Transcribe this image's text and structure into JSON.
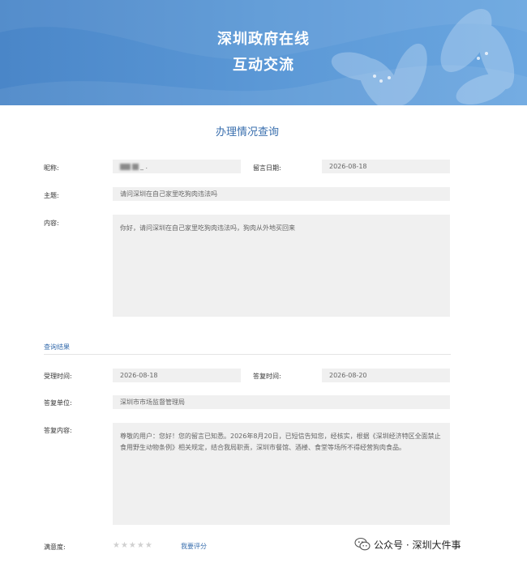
{
  "header": {
    "title_line1": "深圳政府在线",
    "title_line2": "互动交流",
    "colors": {
      "banner": "#4a86c8",
      "accent": "#3a6fae"
    }
  },
  "page_title": "办理情况查询",
  "message": {
    "nickname_label": "昵称:",
    "nickname_visible": "_ . ",
    "date_label": "留言日期:",
    "date": "2026-08-18",
    "subject_label": "主题:",
    "subject": "请问深圳在自己家里吃狗肉违法吗",
    "content_label": "内容:",
    "content": "你好，请问深圳在自己家里吃狗肉违法吗，狗肉从外地买回来"
  },
  "result": {
    "section_title": "查询结果",
    "accept_label": "受理时间:",
    "accept_date": "2026-08-18",
    "reply_time_label": "答复时间:",
    "reply_date": "2026-08-20",
    "unit_label": "答复单位:",
    "unit": "深圳市市场监督管理局",
    "reply_content_label": "答复内容:",
    "reply_content": "尊敬的用户：您好！您的留言已知悉。2026年8月20日，已短信告知您，经核实，根据《深圳经济特区全面禁止食用野生动物条例》相关规定，结合我局职责，深圳市餐馆、酒楼、食堂等场所不得经营狗肉食品。"
  },
  "rating": {
    "label": "满意度:",
    "stars": "★★★★★",
    "star_count": 5,
    "value": 0,
    "link_label": "我要评分"
  },
  "watermark": {
    "text": "公众号 · 深圳大件事",
    "icon": "wechat-icon"
  }
}
